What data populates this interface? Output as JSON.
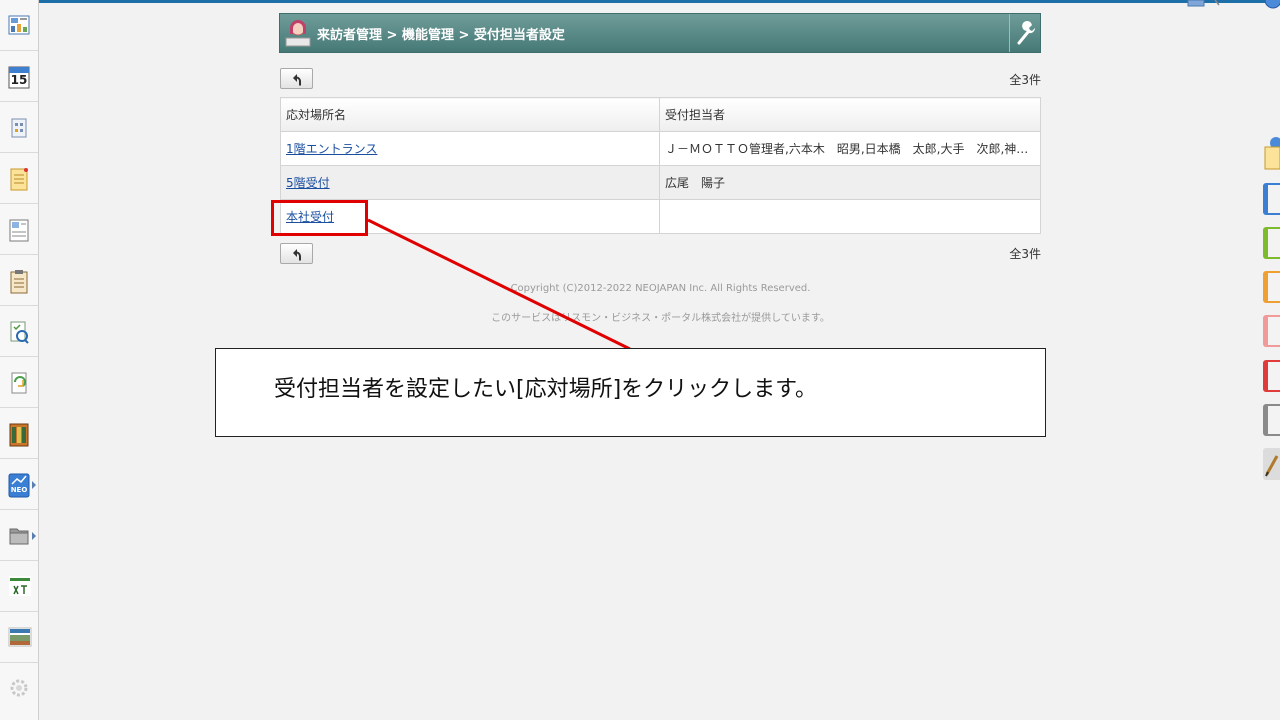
{
  "header": {
    "breadcrumb": "来訪者管理 > 機能管理 > 受付担当者設定"
  },
  "list": {
    "count_top": "全3件",
    "count_bottom": "全3件",
    "columns": [
      "応対場所名",
      "受付担当者"
    ],
    "rows": [
      {
        "place": "1階エントランス",
        "staff": "Ｊ－ＭＯＴＴＯ管理者,六本木　昭男,日本橋　太郎,大手　次郎,神田　五…"
      },
      {
        "place": "5階受付",
        "staff": "広尾　陽子"
      },
      {
        "place": "本社受付",
        "staff": ""
      }
    ]
  },
  "footer": {
    "copyright": "Copyright (C)2012-2022 NEOJAPAN Inc. All Rights Reserved.",
    "provider": "このサービスはリスモン・ビジネス・ポータル株式会社が提供しています。"
  },
  "annotation": {
    "text": "受付担当者を設定したい[応対場所]をクリックします。"
  },
  "sidebar": {
    "items": [
      "portal-icon",
      "calendar-icon",
      "facility-icon",
      "memo-icon",
      "board-icon",
      "clipboard-icon",
      "search-doc-icon",
      "workflow-icon",
      "binder-icon",
      "neo-icon",
      "folder-icon",
      "tanomail-icon",
      "portal-banner-icon",
      "settings-icon"
    ],
    "calendar_day": "15",
    "neo_label": "NEO"
  },
  "colors": {
    "header_top": "#6e9c99",
    "header_bottom": "#467976",
    "link": "#1a4fa0",
    "highlight": "#e00000"
  }
}
